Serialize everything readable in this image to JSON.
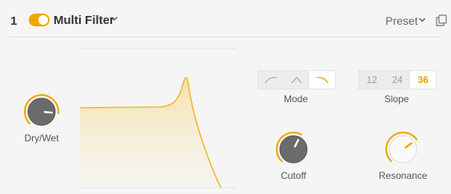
{
  "header": {
    "slot_number": "1",
    "enabled": true,
    "effect_name": "Multi Filter",
    "preset_label": "Preset"
  },
  "controls": {
    "dry_wet": {
      "label": "Dry/Wet",
      "value": 0.85
    },
    "cutoff": {
      "label": "Cutoff",
      "value": 0.6
    },
    "resonance": {
      "label": "Resonance",
      "value": 0.7
    }
  },
  "mode": {
    "label": "Mode",
    "options": [
      "highpass-icon",
      "bandpass-icon",
      "lowpass-icon"
    ],
    "selected": 2
  },
  "slope": {
    "label": "Slope",
    "options": [
      "12",
      "24",
      "36"
    ],
    "selected": 2
  },
  "colors": {
    "accent": "#f0a800",
    "curve": "#f0b838",
    "knob_body": "#6b6b6b",
    "background": "#f5f5f5"
  }
}
